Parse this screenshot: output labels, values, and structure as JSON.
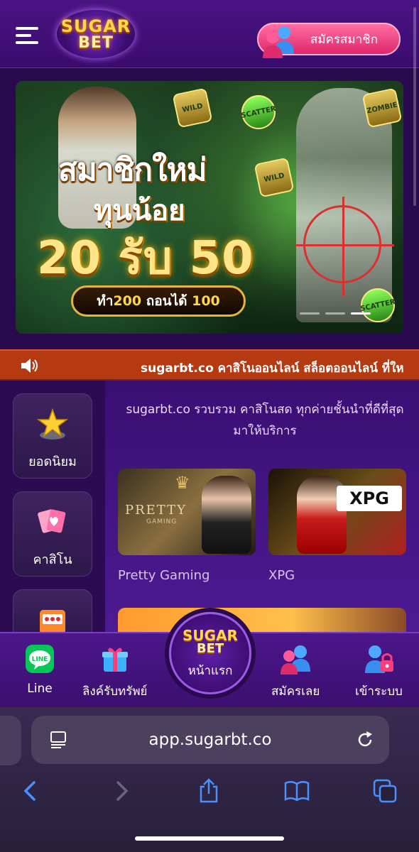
{
  "header": {
    "logo_line1": "SUGAR",
    "logo_line2": "BET",
    "register_label": "สมัครสมาชิก"
  },
  "banner": {
    "headline_1": "สมาชิกใหม่",
    "headline_2": "ทุนน้อย",
    "headline_3": "20 รับ 50",
    "pill_prefix": "ทำ ",
    "pill_num1": "200",
    "pill_mid": " ถอนได้ ",
    "pill_num2": "100",
    "badge_1": "WILD",
    "badge_2": "SCATTER",
    "badge_3": "ZOMBIE",
    "badge_4": "WILD",
    "badge_5": "SCATTER",
    "active_slide": 2
  },
  "marquee": {
    "text": "sugarbt.co คาสิโนออนไลน์ สล็อตออนไลน์ ที่ให"
  },
  "sidebar": {
    "items": [
      {
        "label": "ยอดนิยม"
      },
      {
        "label": "คาสิโน"
      },
      {
        "label": ""
      }
    ]
  },
  "main": {
    "intro": "sugarbt.co รวบรวม คาสิโนสด ทุกค่ายชั้นนำที่ดีที่สุดมาให้บริการ",
    "providers": [
      {
        "name": "Pretty Gaming",
        "logo_text": "PRETTY",
        "logo_sub": "GAMING"
      },
      {
        "name": "XPG",
        "logo_text": "XPG"
      }
    ]
  },
  "bottom_nav": {
    "items": [
      {
        "label": "Line",
        "icon_text": "LINE"
      },
      {
        "label": "ลิงค์รับทรัพย์"
      },
      {
        "label": "หน้าแรก"
      },
      {
        "label": "สมัครเลย"
      },
      {
        "label": "เข้าระบบ"
      }
    ]
  },
  "browser": {
    "url": "app.sugarbt.co"
  },
  "colors": {
    "accent_pink": "#e0266a",
    "marquee_red": "#b53a12",
    "safari_blue": "#4a90ff",
    "gold": "#ffd84a"
  }
}
